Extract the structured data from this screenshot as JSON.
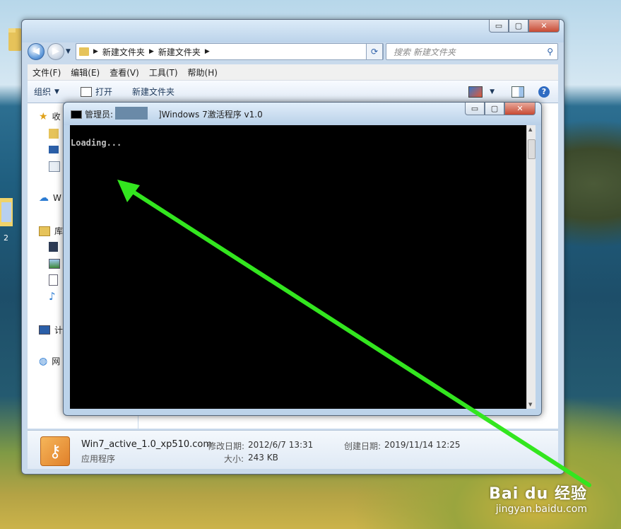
{
  "desktop": {
    "side_label": "2"
  },
  "explorer": {
    "window_controls": {
      "minimize": "▭",
      "maximize": "▢",
      "close": "✕"
    },
    "breadcrumb": [
      "新建文件夹",
      "新建文件夹"
    ],
    "search_placeholder": "搜索 新建文件夹",
    "menu": [
      "文件(F)",
      "编辑(E)",
      "查看(V)",
      "工具(T)",
      "帮助(H)"
    ],
    "toolbar": {
      "organize": "组织",
      "open": "打开",
      "new_folder": "新建文件夹"
    },
    "nav_pane": {
      "favorites": "收",
      "onedrive": "W",
      "libraries": "库",
      "computer": "计",
      "network": "网"
    },
    "details": {
      "filename": "Win7_active_1.0_xp510.com",
      "type": "应用程序",
      "modified_label": "修改日期:",
      "modified_value": "2012/6/7 13:31",
      "created_label": "创建日期:",
      "created_value": "2019/11/14 12:25",
      "size_label": "大小:",
      "size_value": "243 KB"
    }
  },
  "cmd": {
    "title_prefix": "管理员:",
    "title_suffix": "]Windows 7激活程序 v1.0",
    "output": "Loading...",
    "window_controls": {
      "minimize": "▭",
      "maximize": "▢",
      "close": "✕"
    }
  },
  "watermark": {
    "brand": "Bai du 经验",
    "url": "jingyan.baidu.com"
  },
  "colors": {
    "arrow": "#33e61f",
    "console_bg": "#000000",
    "console_text": "#c0c0c0"
  }
}
